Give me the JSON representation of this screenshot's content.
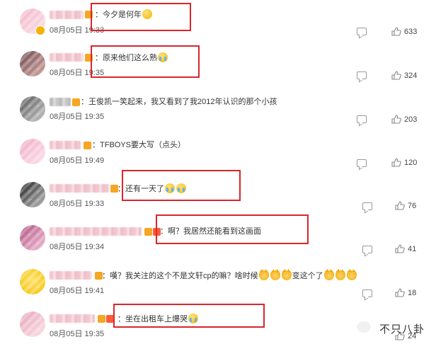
{
  "comments": [
    {
      "text": "：今夕是何年",
      "emojis": [
        "thinking"
      ],
      "date": "08月05日",
      "time": "19:33",
      "likes": "633"
    },
    {
      "text": "：原来他们这么熟",
      "emojis": [
        "cry"
      ],
      "date": "08月05日",
      "time": "19:35",
      "likes": "324"
    },
    {
      "text": "：王俊凯一笑起来，我又看到了我2012年认识的那个小孩",
      "emojis": [],
      "date": "08月05日",
      "time": "19:35",
      "likes": "203"
    },
    {
      "text": "：TFBOYS要大写（点头）",
      "emojis": [],
      "date": "08月05日",
      "time": "19:49",
      "likes": "120"
    },
    {
      "text": "：还有一天了",
      "emojis": [
        "cry",
        "cry"
      ],
      "date": "08月05日",
      "time": "19:33",
      "likes": "76"
    },
    {
      "text": "：啊？我居然还能看到这画面",
      "emojis": [],
      "date": "08月05日",
      "time": "19:34",
      "likes": "41"
    },
    {
      "text": "：嘆？我关注的这个不是文轩cp的嘛？啥时候",
      "text2": "变这个了",
      "emojis": [
        "cat",
        "cat",
        "cat"
      ],
      "emojis2": [
        "cat",
        "cat",
        "cat"
      ],
      "date": "08月05日",
      "time": "19:41",
      "likes": "18"
    },
    {
      "text": "：坐在出租车上爆哭",
      "emojis": [
        "cry"
      ],
      "date": "08月05日",
      "time": "19:35",
      "likes": "24"
    }
  ],
  "watermark": "不只八卦",
  "colors": {
    "highlight_box": "#d9262c",
    "badge_orange": "#f5a623"
  },
  "icons": {
    "comment": "comment-icon",
    "like": "thumbs-up-icon",
    "verified": "verified-badge-icon"
  }
}
